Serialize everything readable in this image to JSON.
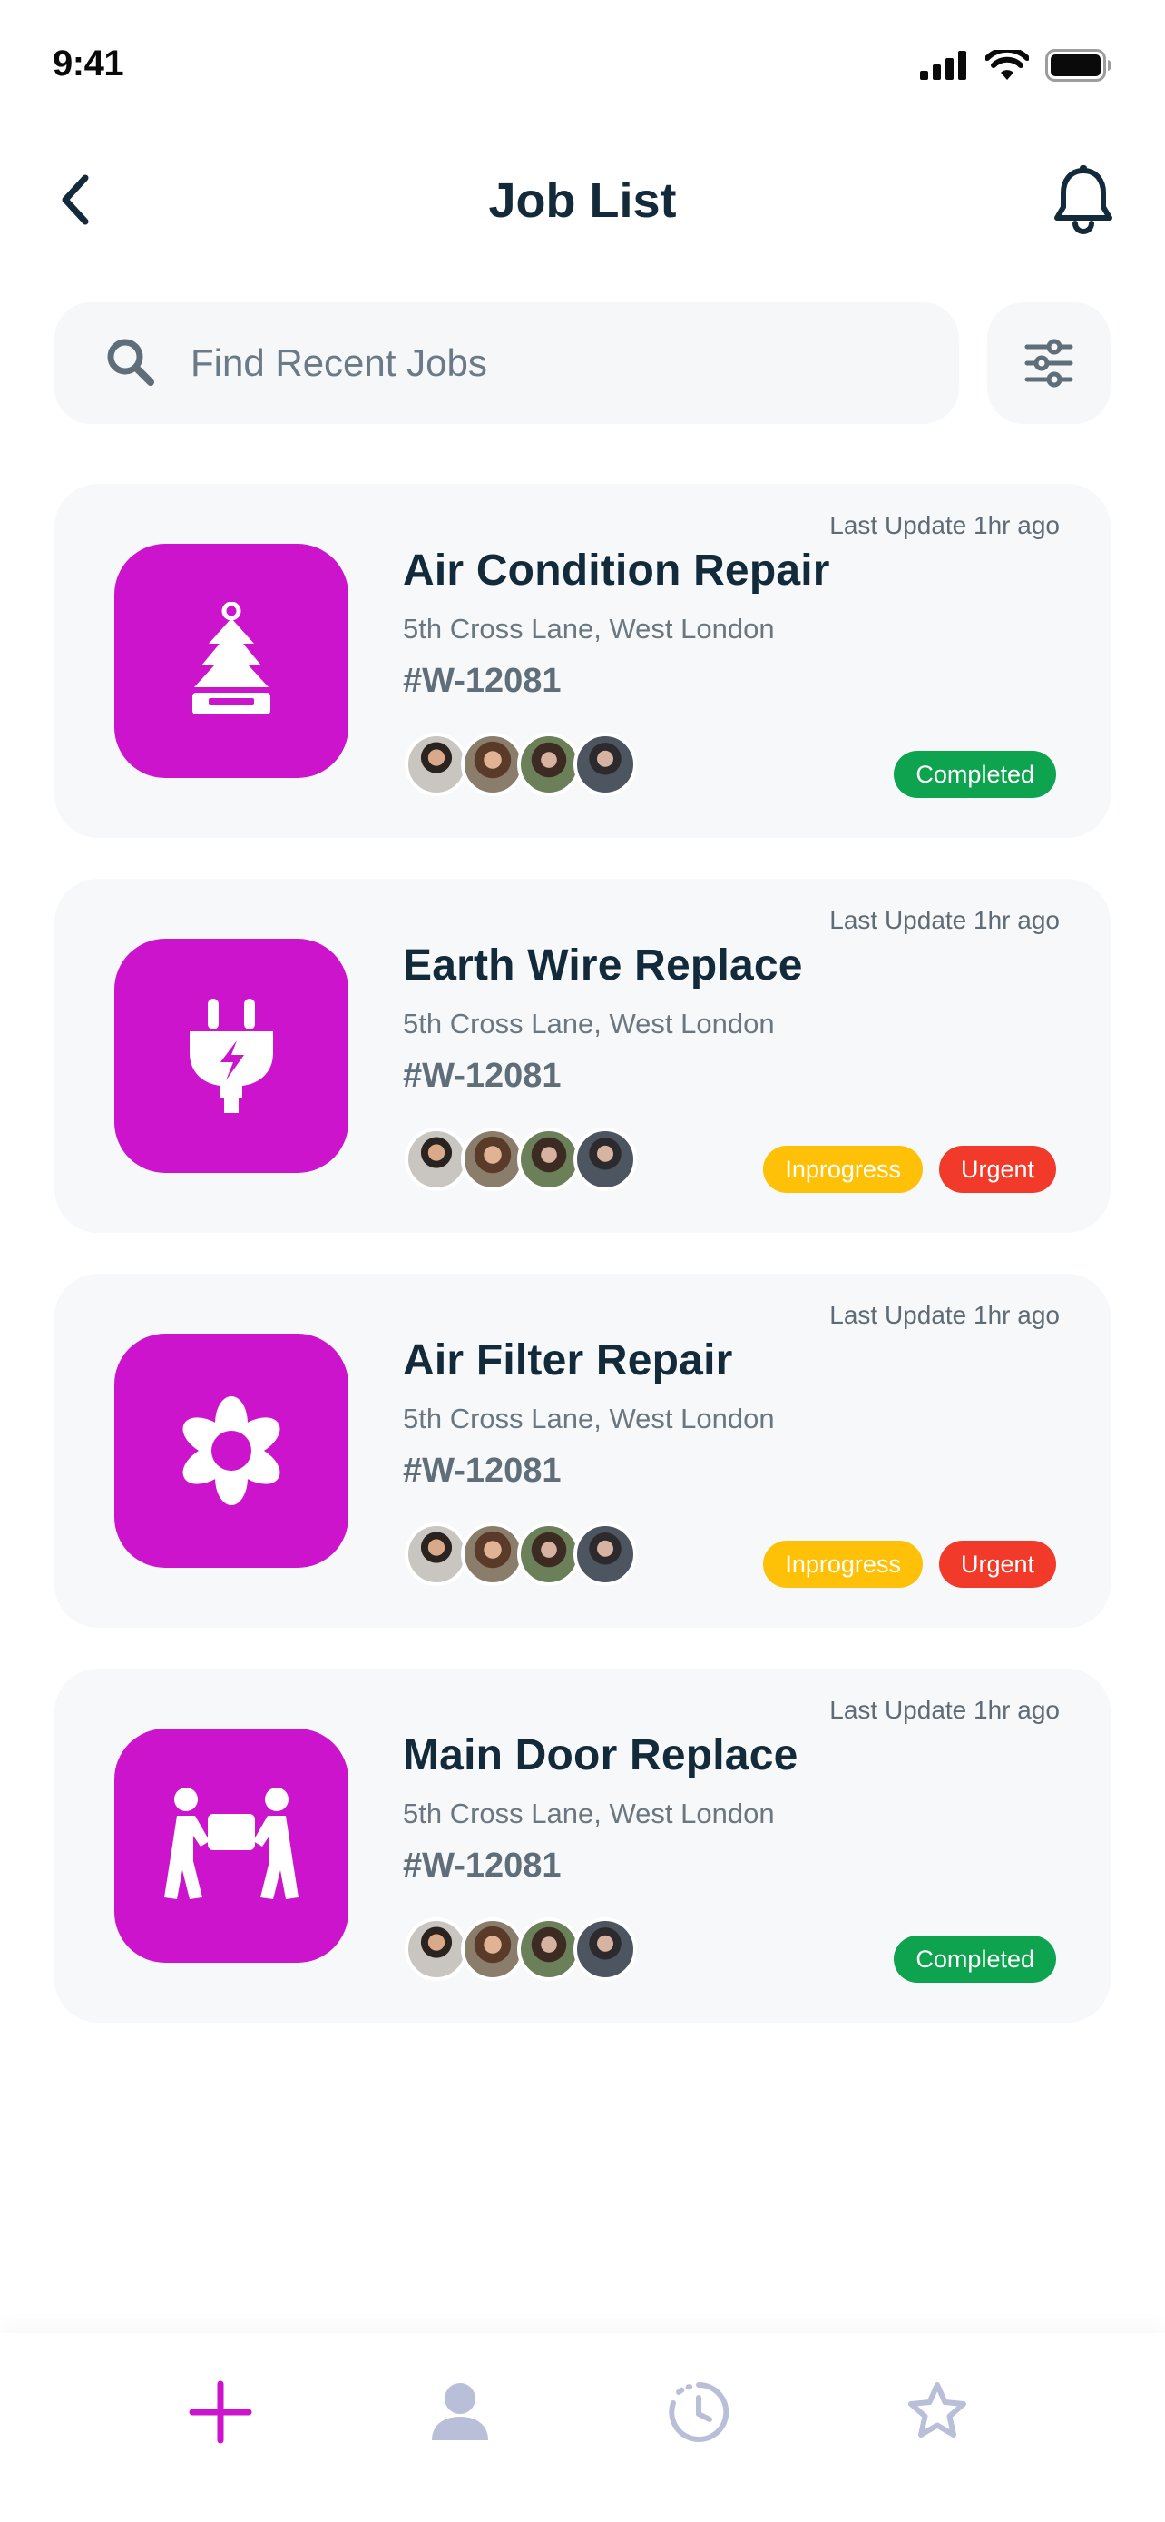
{
  "status_bar": {
    "time": "9:41"
  },
  "header": {
    "title": "Job List"
  },
  "search": {
    "placeholder": "Find Recent Jobs"
  },
  "colors": {
    "accent": "#cc14cc",
    "completed": "#0ea34e",
    "inprogress": "#ffc107",
    "urgent": "#f23a2b",
    "tab_inactive": "#b9bfd8"
  },
  "jobs": [
    {
      "icon": "tree-icon",
      "title": "Air Condition Repair",
      "address": "5th Cross Lane, West London",
      "id": "#W-12081",
      "updated": "Last Update 1hr ago",
      "badges": [
        {
          "label": "Completed",
          "color": "#0ea34e"
        }
      ]
    },
    {
      "icon": "plug-icon",
      "title": "Earth Wire Replace",
      "address": "5th Cross Lane, West London",
      "id": "#W-12081",
      "updated": "Last Update 1hr ago",
      "badges": [
        {
          "label": "Inprogress",
          "color": "#ffc107"
        },
        {
          "label": "Urgent",
          "color": "#f23a2b"
        }
      ]
    },
    {
      "icon": "flower-icon",
      "title": "Air Filter Repair",
      "address": "5th Cross Lane, West London",
      "id": "#W-12081",
      "updated": "Last Update 1hr ago",
      "badges": [
        {
          "label": "Inprogress",
          "color": "#ffc107"
        },
        {
          "label": "Urgent",
          "color": "#f23a2b"
        }
      ]
    },
    {
      "icon": "movers-icon",
      "title": "Main Door Replace",
      "address": "5th Cross Lane, West London",
      "id": "#W-12081",
      "updated": "Last Update 1hr ago",
      "badges": [
        {
          "label": "Completed",
          "color": "#0ea34e"
        }
      ]
    }
  ],
  "tab_bar": {
    "items": [
      {
        "icon": "plus-icon",
        "active": true
      },
      {
        "icon": "user-icon",
        "active": false
      },
      {
        "icon": "history-icon",
        "active": false
      },
      {
        "icon": "star-icon",
        "active": false
      }
    ]
  }
}
